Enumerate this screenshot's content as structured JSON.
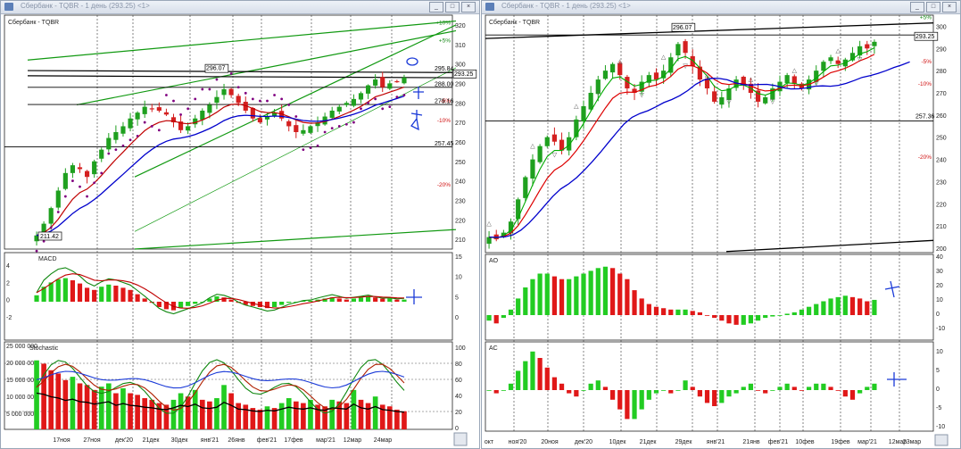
{
  "left_window": {
    "title": "Сбербанк - TQBR - 1 день (293.25) <1>",
    "buttons": [
      "_",
      "□",
      "×"
    ],
    "price_panel_label": "Сбербанк - TQBR",
    "price_axis": [
      "320",
      "310",
      "300",
      "290",
      "280",
      "270",
      "260",
      "250",
      "240",
      "230",
      "220",
      "210"
    ],
    "pct_labels": [
      {
        "t": "+10%",
        "c": "#1a8a1a"
      },
      {
        "t": "+5%",
        "c": "#1a8a1a"
      },
      {
        "t": "-5%",
        "c": "#d01010"
      },
      {
        "t": "-10%",
        "c": "#d01010"
      },
      {
        "t": "-20%",
        "c": "#d01010"
      }
    ],
    "price_tags": [
      "296.07",
      "295.84",
      "293.25",
      "288.00",
      "279.16",
      "257.45",
      "211.42"
    ],
    "macd_label": "MACD",
    "macd_axis_left": [
      "4",
      "2",
      "0",
      "-2"
    ],
    "macd_axis_right": [
      "15",
      "10",
      "5",
      "0"
    ],
    "stoch_label": "Stochastic",
    "volume_axis": [
      "25 000 000",
      "20 000 000",
      "15 000 000",
      "10 000 000",
      "5 000 000"
    ],
    "stoch_axis": [
      "100",
      "80",
      "60",
      "40",
      "20",
      "0"
    ],
    "date_axis": [
      "17ноя",
      "27ноя",
      "дек'20",
      "21дек",
      "30дек",
      "янв'21",
      "26янв",
      "фев'21",
      "17фев",
      "мар'21",
      "12мар",
      "24мар"
    ]
  },
  "right_window": {
    "title": "Сбербанк - TQBR - 1 день (293.25) <1>",
    "buttons": [
      "_",
      "□",
      "×"
    ],
    "price_panel_label": "Сбербанк - TQBR",
    "price_axis": [
      "300",
      "290",
      "280",
      "270",
      "260",
      "250",
      "240",
      "230",
      "220",
      "210",
      "200"
    ],
    "pct_labels": [
      {
        "t": "+5%",
        "c": "#1a8a1a"
      },
      {
        "t": "-5%",
        "c": "#d01010"
      },
      {
        "t": "-10%",
        "c": "#d01010"
      },
      {
        "t": "-20%",
        "c": "#d01010"
      }
    ],
    "price_tags": [
      "296.07",
      "296.07",
      "293.25",
      "257.36"
    ],
    "ao_label": "AO",
    "ao_axis": [
      "40",
      "30",
      "20",
      "10",
      "0",
      "-10"
    ],
    "ac_label": "AC",
    "ac_axis": [
      "10",
      "5",
      "0",
      "-5",
      "-10"
    ],
    "date_axis": [
      "окт",
      "ноя'20",
      "20ноя",
      "дек'20",
      "10дек",
      "21дек",
      "29дек",
      "янв'21",
      "21янв",
      "фев'21",
      "10фев",
      "19фев",
      "мар'21",
      "12мар",
      "23мар"
    ]
  },
  "chart_data": [
    {
      "type": "candlestick",
      "title": "Сбербанк - TQBR - 1 день (293.25)",
      "ylim": [
        205,
        325
      ],
      "grid": true,
      "closes": [
        212,
        218,
        226,
        235,
        244,
        248,
        246,
        242,
        250,
        256,
        262,
        265,
        268,
        272,
        275,
        278,
        277,
        276,
        274,
        270,
        266,
        268,
        272,
        276,
        279,
        283,
        287,
        284,
        280,
        276,
        272,
        270,
        273,
        275,
        272,
        268,
        265,
        266,
        268,
        270,
        273,
        276,
        278,
        280,
        282,
        285,
        289,
        292,
        288,
        290,
        291,
        293
      ],
      "series": [
        {
          "name": "EMA fast",
          "color": "#c00000"
        },
        {
          "name": "EMA slow",
          "color": "#0000cc"
        },
        {
          "name": "Parabolic SAR",
          "color": "#800080"
        }
      ]
    },
    {
      "type": "bar",
      "title": "MACD",
      "ylim": [
        -4,
        5
      ],
      "values": [
        1.2,
        2.8,
        3.6,
        4.2,
        4.4,
        4.0,
        3.4,
        2.6,
        2.2,
        2.8,
        3.2,
        3.0,
        2.6,
        2.2,
        1.4,
        0.6,
        -0.2,
        -1.0,
        -1.4,
        -1.6,
        -1.2,
        -0.8,
        -0.4,
        0.0,
        0.6,
        1.0,
        0.8,
        0.4,
        -0.2,
        -0.6,
        -0.8,
        -1.0,
        -1.2,
        -1.0,
        -0.6,
        -0.2,
        0.0,
        0.2,
        0.2,
        0.4,
        0.6,
        0.8,
        0.6,
        0.4,
        0.6,
        0.8,
        1.0,
        0.8,
        0.6,
        0.6,
        0.4,
        0.4
      ]
    },
    {
      "type": "bar",
      "title": "Stochastic",
      "ylim": [
        0,
        25000000
      ],
      "values": [
        21000000,
        20000000,
        18000000,
        17000000,
        15000000,
        16000000,
        14000000,
        13500000,
        12000000,
        13000000,
        14000000,
        11000000,
        12500000,
        11000000,
        10500000,
        9500000,
        9000000,
        8000000,
        7500000,
        9000000,
        11000000,
        10000000,
        12000000,
        9000000,
        8500000,
        9500000,
        13500000,
        11000000,
        8000000,
        7500000,
        6500000,
        6000000,
        7000000,
        6500000,
        8000000,
        9500000,
        8500000,
        8000000,
        9000000,
        7500000,
        7000000,
        9000000,
        8500000,
        8000000,
        12000000,
        9000000,
        8000000,
        10000000,
        7500000,
        7000000,
        6000000,
        5500000
      ]
    },
    {
      "type": "candlestick",
      "title": "Сбербанк - TQBR - 1 день (293.25)",
      "ylim": [
        198,
        305
      ],
      "grid": true,
      "closes": [
        205,
        204,
        207,
        212,
        222,
        232,
        240,
        246,
        250,
        248,
        244,
        250,
        258,
        264,
        270,
        276,
        280,
        283,
        278,
        272,
        270,
        275,
        278,
        276,
        280,
        286,
        292,
        288,
        282,
        276,
        272,
        266,
        268,
        272,
        276,
        274,
        270,
        266,
        268,
        272,
        275,
        278,
        274,
        272,
        276,
        280,
        284,
        286,
        283,
        285,
        288,
        291,
        290,
        293
      ],
      "series": [
        {
          "name": "Alligator lips",
          "color": "#00aa00"
        },
        {
          "name": "Alligator teeth",
          "color": "#dd0000"
        },
        {
          "name": "Alligator jaw",
          "color": "#0000cc"
        }
      ]
    },
    {
      "type": "bar",
      "title": "AO",
      "ylim": [
        -12,
        40
      ],
      "values": [
        -4,
        -6,
        -2,
        4,
        12,
        20,
        26,
        30,
        30,
        28,
        26,
        26,
        28,
        30,
        32,
        34,
        35,
        34,
        30,
        26,
        18,
        12,
        8,
        6,
        5,
        4,
        4,
        4,
        3,
        2,
        0,
        -2,
        -4,
        -6,
        -7,
        -7,
        -6,
        -4,
        -2,
        -1,
        0,
        1,
        2,
        4,
        6,
        8,
        10,
        12,
        13,
        14,
        13,
        12,
        10,
        11
      ]
    },
    {
      "type": "bar",
      "title": "AC",
      "ylim": [
        -12,
        14
      ],
      "values": [
        0,
        -1,
        0,
        2,
        6,
        9,
        12,
        10,
        7,
        4,
        2,
        -1,
        -2,
        0,
        2,
        3,
        1,
        -3,
        -6,
        -9,
        -9,
        -6,
        -3,
        -1,
        0,
        -1,
        0,
        3,
        1,
        -2,
        -4,
        -5,
        -4,
        -2,
        -1,
        1,
        2,
        0,
        -1,
        0,
        1,
        2,
        1,
        0,
        1,
        2,
        2,
        1,
        0,
        -2,
        -3,
        -1,
        1,
        2
      ]
    }
  ]
}
